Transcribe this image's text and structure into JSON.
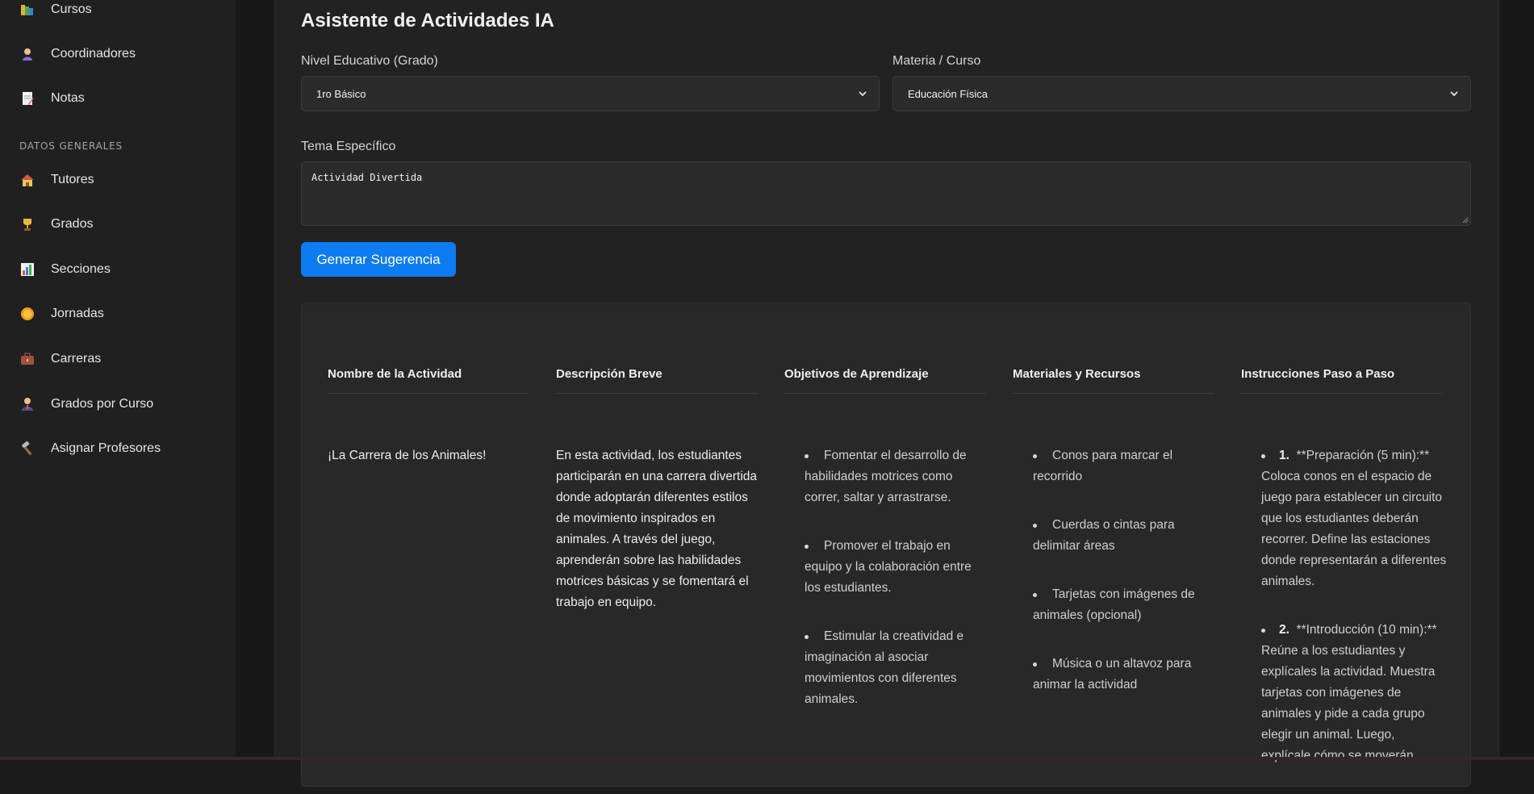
{
  "sidebar": {
    "items_top": [
      {
        "label": "Cursos",
        "icon": "books-icon"
      },
      {
        "label": "Coordinadores",
        "icon": "person-icon"
      },
      {
        "label": "Notas",
        "icon": "memo-icon"
      }
    ],
    "section_label": "DATOS GENERALES",
    "items": [
      {
        "label": "Tutores",
        "icon": "house-icon"
      },
      {
        "label": "Grados",
        "icon": "trophy-icon"
      },
      {
        "label": "Secciones",
        "icon": "bar-chart-icon"
      },
      {
        "label": "Jornadas",
        "icon": "sun-icon"
      },
      {
        "label": "Carreras",
        "icon": "briefcase-icon"
      },
      {
        "label": "Grados por Curso",
        "icon": "teacher-icon"
      },
      {
        "label": "Asignar Profesores",
        "icon": "hammer-icon"
      }
    ]
  },
  "page": {
    "title": "Asistente de Actividades IA"
  },
  "form": {
    "level_label": "Nivel Educativo (Grado)",
    "level_value": "1ro Básico",
    "subject_label": "Materia / Curso",
    "subject_value": "Educación Física",
    "topic_label": "Tema Específico",
    "topic_value": "Actividad Divertida",
    "generate_label": "Generar Sugerencia"
  },
  "result": {
    "headers": [
      "Nombre de la Actividad",
      "Descripción Breve",
      "Objetivos de Aprendizaje",
      "Materiales y Recursos",
      "Instrucciones Paso a Paso"
    ],
    "name": "¡La Carrera de los Animales!",
    "description": "En esta actividad, los estudiantes participarán en una carrera divertida donde adoptarán diferentes estilos de movimiento inspirados en animales. A través del juego, aprenderán sobre las habilidades motrices básicas y se fomentará el trabajo en equipo.",
    "objectives": [
      "Fomentar el desarrollo de habilidades motrices como correr, saltar y arrastrarse.",
      "Promover el trabajo en equipo y la colaboración entre los estudiantes.",
      "Estimular la creatividad e imaginación al asociar movimientos con diferentes animales."
    ],
    "materials": [
      "Conos para marcar el recorrido",
      "Cuerdas o cintas para delimitar áreas",
      "Tarjetas con imágenes de animales (opcional)",
      "Música o un altavoz para animar la actividad"
    ],
    "steps": [
      {
        "num": "1.",
        "text": "**Preparación (5 min):** Coloca conos en el espacio de juego para establecer un circuito que los estudiantes deberán recorrer. Define las estaciones donde representarán a diferentes animales."
      },
      {
        "num": "2.",
        "text": "**Introducción (10 min):** Reúne a los estudiantes y explícales la actividad. Muestra tarjetas con imágenes de animales y pide a cada grupo elegir un animal. Luego, explícale cómo se moverán"
      }
    ]
  }
}
